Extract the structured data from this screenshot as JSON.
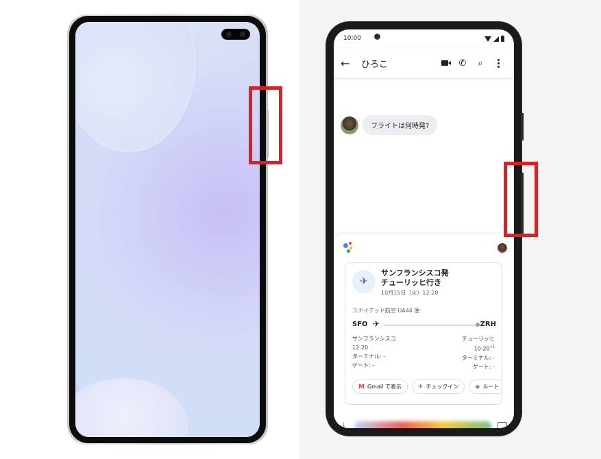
{
  "left_phone": {
    "label": ""
  },
  "right_phone": {
    "status_time": "10:00",
    "appbar": {
      "back_icon": "arrow-back",
      "title": "ひろこ"
    },
    "message": {
      "text": "フライトは何時発?"
    },
    "flight_card": {
      "title_line1": "サンフランシスコ発",
      "title_line2": "チューリッヒ行き",
      "date": "10月15日（火）12:20",
      "airline": "ユナイテッド航空 UA44 便",
      "from_code": "SFO",
      "to_code": "ZRH",
      "from_city": "サンフランシスコ",
      "from_time": "12:20",
      "from_terminal": "ターミナル: -",
      "from_gate": "ゲート: -",
      "to_city": "チューリッヒ",
      "to_time": "10:20",
      "to_time_sup": "+1",
      "to_terminal": "ターミナル: -",
      "to_gate": "ゲート: -",
      "chips": [
        "Gmail で表示",
        "チェックイン",
        "ルート"
      ]
    }
  },
  "highlight_color": "#e01e22"
}
